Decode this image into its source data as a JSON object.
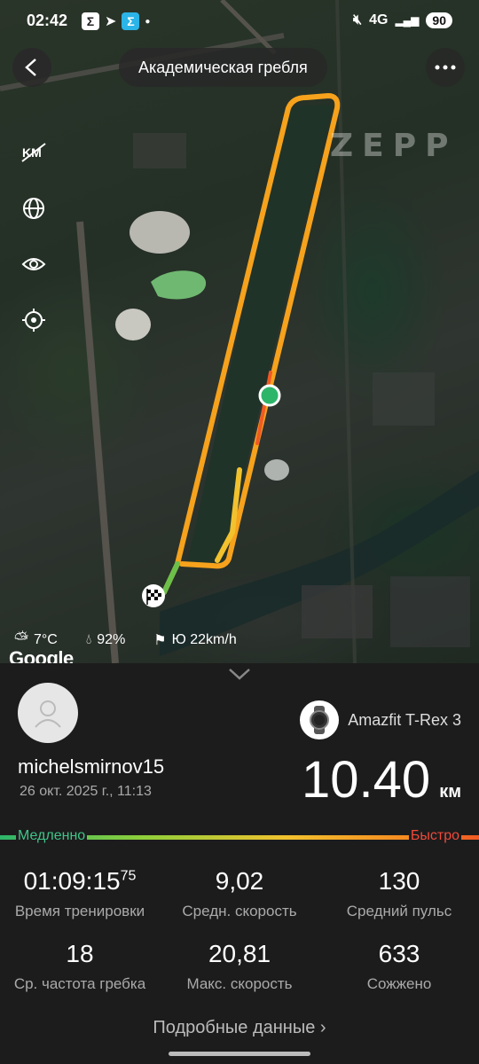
{
  "status_bar": {
    "time": "02:42",
    "network": "4G",
    "battery": "90"
  },
  "header": {
    "title": "Академическая гребля",
    "back_icon": "chevron-left-icon",
    "more_icon": "more-dots-icon"
  },
  "watermark": "ZEPP",
  "map_controls": [
    {
      "name": "km-markers-toggle-icon"
    },
    {
      "name": "globe-icon"
    },
    {
      "name": "eye-icon"
    },
    {
      "name": "locate-icon"
    }
  ],
  "weather": {
    "temperature": "7°C",
    "humidity": "92%",
    "wind": "Ю 22km/h"
  },
  "map_attribution": "Google",
  "workout": {
    "username": "michelsmirnov15",
    "datetime": "26 окт. 2025 г., 11:13",
    "device": "Amazfit T-Rex 3",
    "distance": "10.40",
    "distance_unit": "км"
  },
  "speed_legend": {
    "slow": "Медленно",
    "fast": "Быстро",
    "colors": [
      "#2db56a",
      "#8fcf3a",
      "#f2c12e",
      "#f58a20",
      "#f05a24"
    ]
  },
  "stats": {
    "duration_main": "01:09:15",
    "duration_fraction": "75",
    "duration_label": "Время тренировки",
    "avg_speed": "9,02",
    "avg_speed_label": "Средн. скорость",
    "avg_hr": "130",
    "avg_hr_label": "Средний пульс",
    "stroke_rate": "18",
    "stroke_rate_label": "Ср. частота гребка",
    "max_speed": "20,81",
    "max_speed_label": "Макс. скорость",
    "calories": "633",
    "calories_label": "Сожжено"
  },
  "details_link": "Подробные данные"
}
